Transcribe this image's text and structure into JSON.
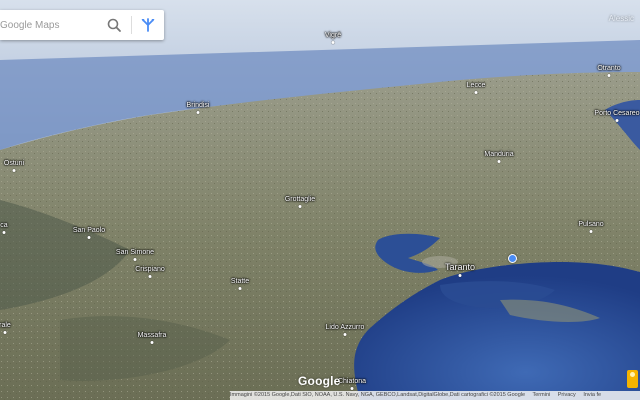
{
  "search": {
    "placeholder": "Google Maps"
  },
  "user": "Alessic",
  "places": [
    {
      "name": "Vigrē",
      "kind": "city"
    },
    {
      "name": "Otranto",
      "kind": "city"
    },
    {
      "name": "Lecce",
      "kind": "city"
    },
    {
      "name": "Brindisi",
      "kind": "city"
    },
    {
      "name": "Porto Cesareo",
      "kind": "city"
    },
    {
      "name": "Ostuni",
      "kind": "city"
    },
    {
      "name": "Manduria",
      "kind": "city"
    },
    {
      "name": "Grottaglie",
      "kind": "city"
    },
    {
      "name": "ca",
      "kind": "city"
    },
    {
      "name": "San Paolo",
      "kind": "city"
    },
    {
      "name": "San Simone",
      "kind": "city"
    },
    {
      "name": "Pulsano",
      "kind": "city"
    },
    {
      "name": "Taranto",
      "kind": "city"
    },
    {
      "name": "Crispiano",
      "kind": "city"
    },
    {
      "name": "Statte",
      "kind": "city"
    },
    {
      "name": "rale",
      "kind": "city"
    },
    {
      "name": "Lido Azzurro",
      "kind": "city"
    },
    {
      "name": "Massafra",
      "kind": "city"
    },
    {
      "name": "Chiatona",
      "kind": "city"
    }
  ],
  "logo": "Google",
  "footer": {
    "attribution": "Immagini ©2015 Google,Dati SIO, NOAA, U.S. Navy, NGA, GEBCO,Landsat,DigitalGlobe,Dati cartografici ©2015 Google",
    "terms": "Termini",
    "privacy": "Privacy",
    "feedback": "Invia fe"
  },
  "colors": {
    "sea": "#2f4f9c",
    "land": "#8a8a72",
    "sky": "#c9d5e6",
    "location": "#4a8cf5"
  }
}
